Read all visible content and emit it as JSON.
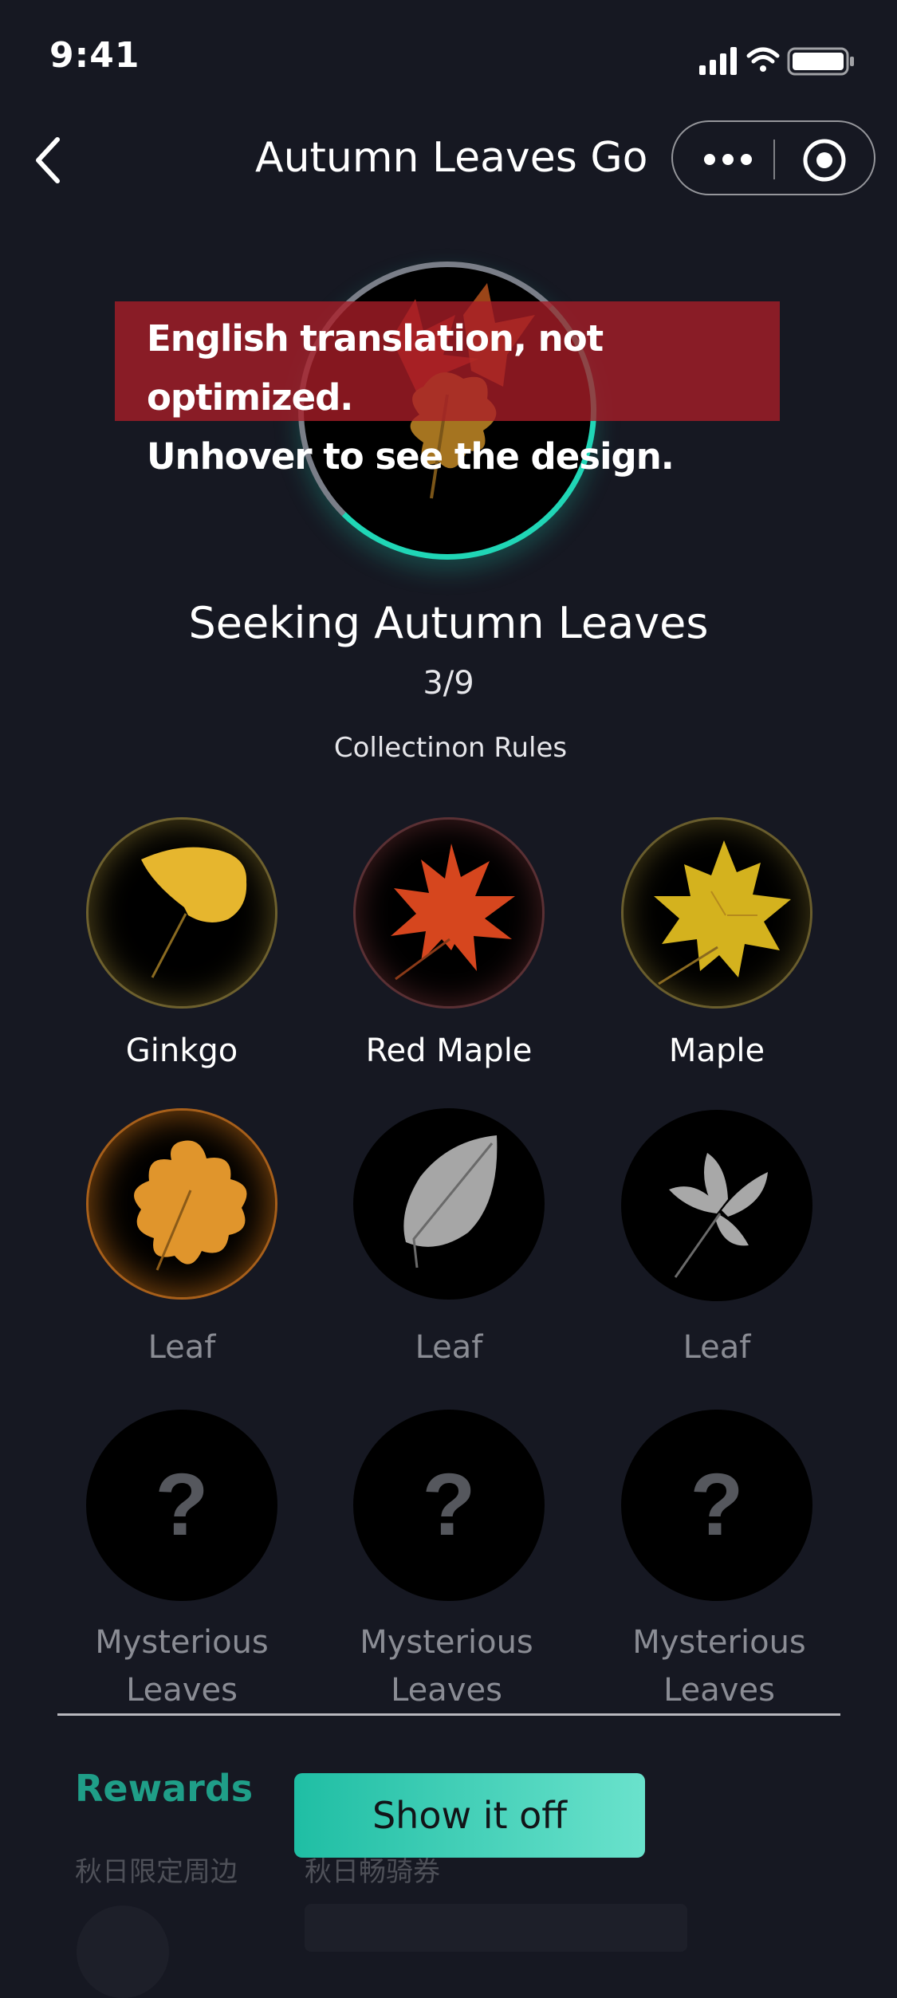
{
  "status_bar": {
    "time": "9:41"
  },
  "nav": {
    "title": "Autumn Leaves Go"
  },
  "banner": {
    "line1": "English translation, not optimized.",
    "line2": "Unhover to see the design."
  },
  "collection": {
    "title": "Seeking Autumn Leaves",
    "count": "3/9",
    "rules_label": "Collectinon Rules"
  },
  "leaves": [
    {
      "label": "Ginkgo"
    },
    {
      "label": "Red Maple"
    },
    {
      "label": "Maple"
    },
    {
      "label": "Leaf"
    },
    {
      "label": "Leaf"
    },
    {
      "label": "Leaf"
    },
    {
      "label_line1": "Mysterious",
      "label_line2": "Leaves",
      "glyph": "?"
    },
    {
      "label_line1": "Mysterious",
      "label_line2": "Leaves",
      "glyph": "?"
    },
    {
      "label_line1": "Mysterious",
      "label_line2": "Leaves",
      "glyph": "?"
    }
  ],
  "rewards": {
    "title": "Rewards",
    "item1": "秋日限定周边",
    "item2": "秋日畅骑券"
  },
  "cta": {
    "label": "Show it off"
  },
  "colors": {
    "background": "#161822",
    "accent": "#20d6b6",
    "rewards_title": "#1f9e88"
  }
}
